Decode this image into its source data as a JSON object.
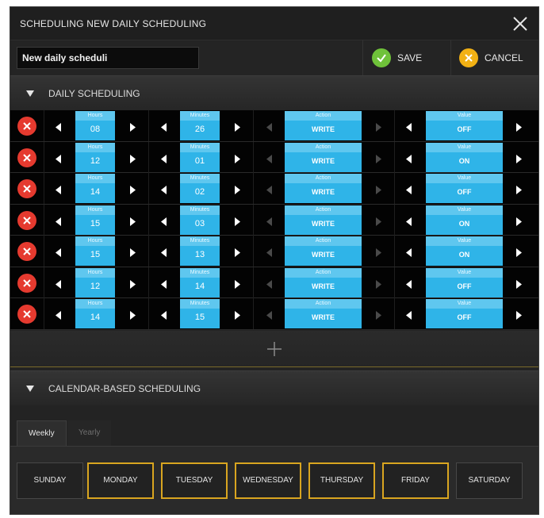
{
  "title": "SCHEDULING NEW DAILY SCHEDULING",
  "name_input": {
    "value": "New daily scheduli"
  },
  "save": {
    "label": "SAVE",
    "color": "#6fc23a"
  },
  "cancel": {
    "label": "CANCEL",
    "color": "#f2b114"
  },
  "daily_section": {
    "label": "DAILY SCHEDULING"
  },
  "captions": {
    "hours": "Hours",
    "minutes": "Minutes",
    "action": "Action",
    "value": "Value"
  },
  "rows": [
    {
      "hours": "08",
      "minutes": "26",
      "action": "WRITE",
      "value": "OFF"
    },
    {
      "hours": "12",
      "minutes": "01",
      "action": "WRITE",
      "value": "ON"
    },
    {
      "hours": "14",
      "minutes": "02",
      "action": "WRITE",
      "value": "OFF"
    },
    {
      "hours": "15",
      "minutes": "03",
      "action": "WRITE",
      "value": "ON"
    },
    {
      "hours": "15",
      "minutes": "13",
      "action": "WRITE",
      "value": "ON"
    },
    {
      "hours": "12",
      "minutes": "14",
      "action": "WRITE",
      "value": "OFF"
    },
    {
      "hours": "14",
      "minutes": "15",
      "action": "WRITE",
      "value": "OFF"
    }
  ],
  "calendar_section": {
    "label": "CALENDAR-BASED SCHEDULING"
  },
  "tabs": [
    {
      "label": "Weekly",
      "active": true
    },
    {
      "label": "Yearly",
      "active": false
    }
  ],
  "days": [
    {
      "label": "SUNDAY",
      "selected": false
    },
    {
      "label": "MONDAY",
      "selected": true
    },
    {
      "label": "TUESDAY",
      "selected": true
    },
    {
      "label": "WEDNESDAY",
      "selected": true
    },
    {
      "label": "THURSDAY",
      "selected": true
    },
    {
      "label": "FRIDAY",
      "selected": true
    },
    {
      "label": "SATURDAY",
      "selected": false
    }
  ],
  "accent_color": "#2fb4e8",
  "selected_border_color": "#d9a520"
}
